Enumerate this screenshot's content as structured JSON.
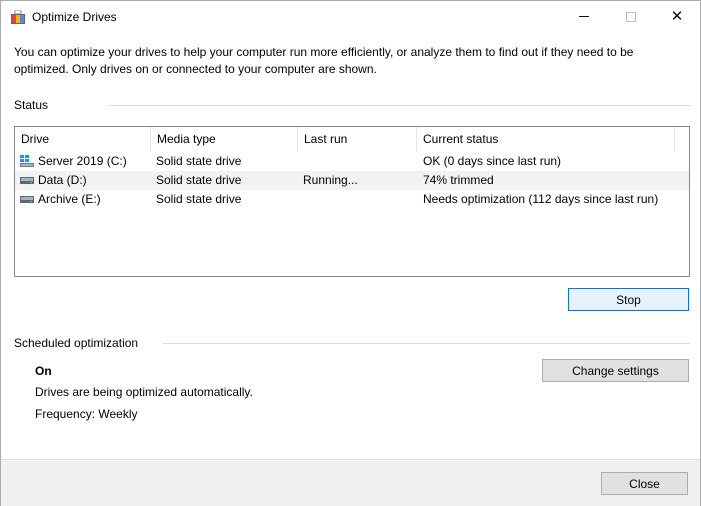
{
  "window": {
    "title": "Optimize Drives",
    "minimize_icon": "minimize-icon",
    "maximize_icon": "maximize-icon",
    "close_icon": "close-icon"
  },
  "intro_text": "You can optimize your drives to help your computer run more efficiently, or analyze them to find out if they need to be optimized. Only drives on or connected to your computer are shown.",
  "status": {
    "label": "Status",
    "columns": [
      "Drive",
      "Media type",
      "Last run",
      "Current status"
    ],
    "drives": [
      {
        "icon": "windows-drive-icon",
        "name": "Server 2019 (C:)",
        "media_type": "Solid state drive",
        "last_run": "",
        "current_status": "OK (0 days since last run)"
      },
      {
        "icon": "drive-icon",
        "name": "Data (D:)",
        "media_type": "Solid state drive",
        "last_run": "Running...",
        "current_status": "74% trimmed"
      },
      {
        "icon": "drive-icon",
        "name": "Archive (E:)",
        "media_type": "Solid state drive",
        "last_run": "",
        "current_status": "Needs optimization (112 days since last run)"
      }
    ],
    "stop_button": "Stop"
  },
  "scheduled": {
    "label": "Scheduled optimization",
    "state": "On",
    "description": "Drives are being optimized automatically.",
    "frequency": "Frequency: Weekly",
    "change_settings_button": "Change settings"
  },
  "footer": {
    "close_button": "Close"
  },
  "colors": {
    "accent_border": "#0078d7",
    "accent_fill": "#e5f1fb",
    "footer_bg": "#f0f0f0"
  }
}
